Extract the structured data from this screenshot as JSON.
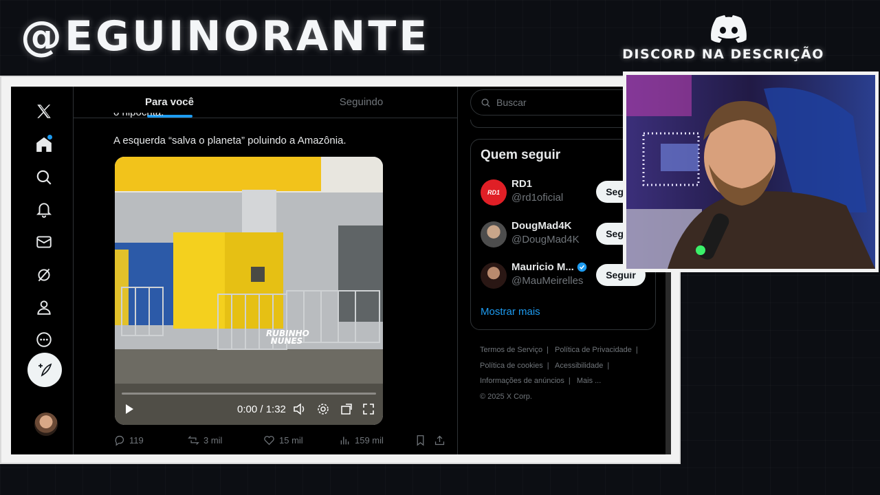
{
  "overlay": {
    "channel_handle": "@EGUINORANTE",
    "discord_text": "DISCORD NA DESCRIÇÃO"
  },
  "tabs": [
    {
      "label": "Para você",
      "active": true
    },
    {
      "label": "Seguindo",
      "active": false
    }
  ],
  "tweet": {
    "clipped_text": "o hipócrita.",
    "text": "A esquerda “salva o planeta” poluindo a Amazônia.",
    "video": {
      "time": "0:00 / 1:32",
      "watermark": "RUBINHO NUNES"
    },
    "stats": {
      "replies": "119",
      "reposts": "3 mil",
      "likes": "15 mil",
      "views": "159 mil"
    }
  },
  "search": {
    "placeholder": "Buscar"
  },
  "who_to_follow": {
    "title": "Quem seguir",
    "accounts": [
      {
        "name": "RD1",
        "handle": "@rd1oficial",
        "button": "Seguir",
        "avatar_text": "RD1",
        "verified": false
      },
      {
        "name": "DougMad4K",
        "handle": "@DougMad4K",
        "button": "Seguir",
        "verified": false
      },
      {
        "name": "Mauricio M...",
        "handle": "@MauMeirelles",
        "button": "Seguir",
        "verified": true
      }
    ],
    "show_more": "Mostrar mais"
  },
  "footer": {
    "links": [
      "Termos de Serviço",
      "Política de Privacidade",
      "Política de cookies",
      "Acessibilidade",
      "Informações de anúncios",
      "Mais ..."
    ],
    "copyright": "© 2025 X Corp."
  },
  "colors": {
    "accent": "#1d9bf0",
    "background": "#000000",
    "muted_text": "#71767b",
    "video_yellow": "#f2c31b"
  }
}
